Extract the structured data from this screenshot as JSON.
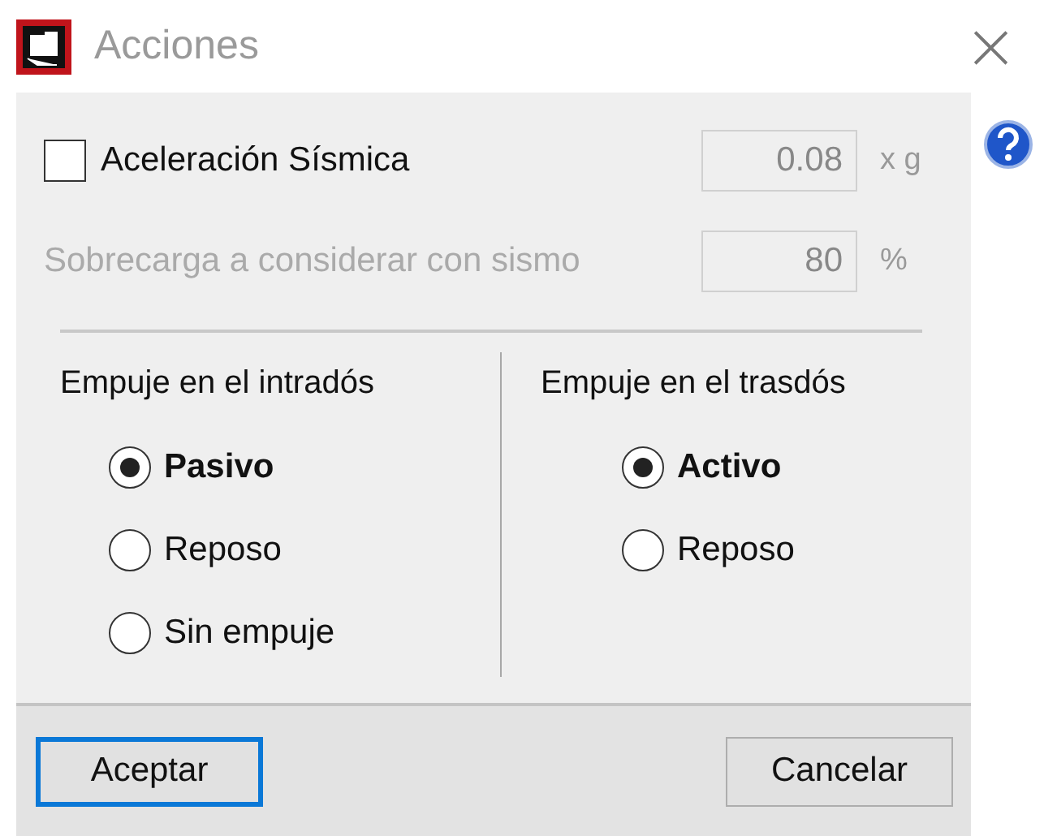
{
  "window": {
    "title": "Acciones",
    "close": "×"
  },
  "seismic": {
    "label": "Aceleración Sísmica",
    "checked": false,
    "value": "0.08",
    "unit": "x g",
    "disabled": true
  },
  "overload": {
    "label": "Sobrecarga a considerar con sismo",
    "value": "80",
    "unit": "%",
    "disabled": true
  },
  "groups": [
    {
      "title": "Empuje en el intradós",
      "options": [
        {
          "label": "Pasivo",
          "selected": true
        },
        {
          "label": "Reposo",
          "selected": false
        },
        {
          "label": "Sin empuje",
          "selected": false
        }
      ]
    },
    {
      "title": "Empuje en el trasdós",
      "options": [
        {
          "label": "Activo",
          "selected": true
        },
        {
          "label": "Reposo",
          "selected": false
        }
      ]
    }
  ],
  "buttons": [
    {
      "label": "Aceptar",
      "default": true
    },
    {
      "label": "Cancelar",
      "default": false
    }
  ]
}
